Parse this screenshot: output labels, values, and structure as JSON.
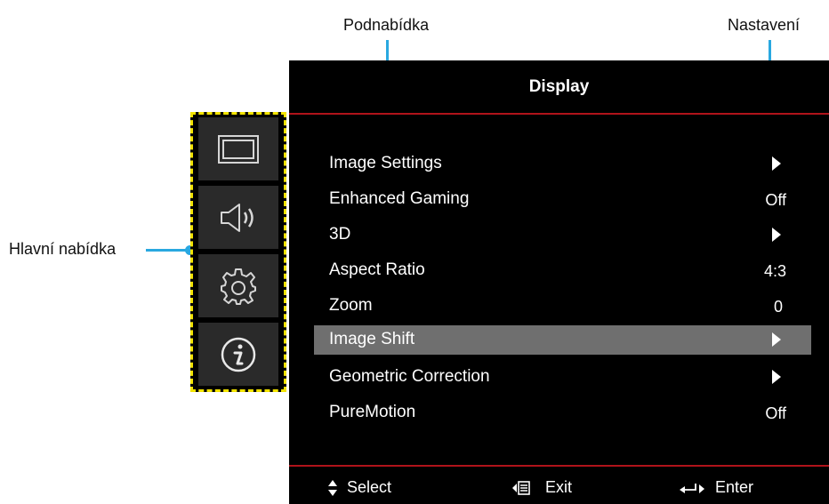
{
  "callouts": {
    "submenu": "Podnabídka",
    "settings": "Nastavení",
    "main_menu": "Hlavní nabídka"
  },
  "osd": {
    "title": "Display",
    "rows": [
      {
        "label": "Image Settings",
        "value": "",
        "type": "arrow"
      },
      {
        "label": "Enhanced Gaming",
        "value": "Off",
        "type": "text"
      },
      {
        "label": "3D",
        "value": "",
        "type": "arrow"
      },
      {
        "label": "Aspect Ratio",
        "value": "4:3",
        "type": "text"
      },
      {
        "label": "Zoom",
        "value": "0",
        "type": "text"
      },
      {
        "label": "Image Shift",
        "value": "",
        "type": "arrow",
        "selected": true
      },
      {
        "label": "Geometric Correction",
        "value": "",
        "type": "arrow"
      },
      {
        "label": "PureMotion",
        "value": "Off",
        "type": "text"
      }
    ],
    "footer": {
      "select": "Select",
      "exit": "Exit",
      "enter": "Enter"
    }
  },
  "sidebar_icons": [
    "display-icon",
    "audio-icon",
    "setup-icon",
    "info-icon"
  ],
  "colors": {
    "accent_line": "#b0131a",
    "callout": "#29a8e0",
    "highlight": "#6f6f6f",
    "frame": "#f2e300"
  }
}
